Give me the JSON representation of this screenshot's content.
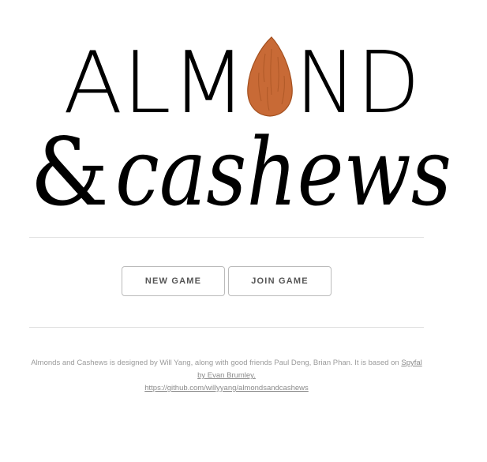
{
  "logo": {
    "title_part1": "ALM",
    "title_part2": "ND",
    "ampersand": "&",
    "script_word": "cashews",
    "almond_icon": "almond-icon",
    "almond_color": "#c86a36"
  },
  "buttons": {
    "new_game": "NEW GAME",
    "join_game": "JOIN GAME"
  },
  "footer": {
    "text_before": "Almonds and Cashews is designed by Will Yang, along with good friends Paul Deng, Brian Phan. It is based on ",
    "spyfall_link": "Spyfal by Evan Brumley.",
    "github_link": "https://github.com/willyyang/almondsandcashews"
  }
}
